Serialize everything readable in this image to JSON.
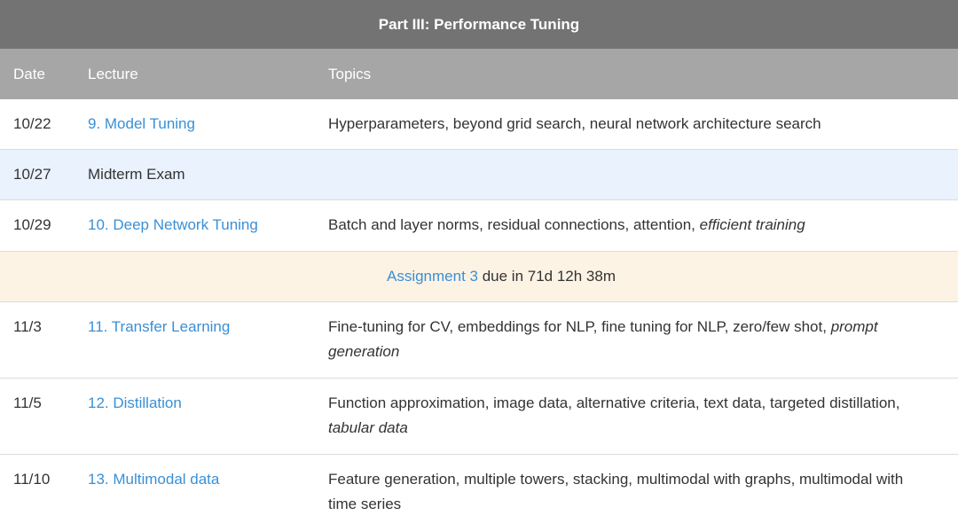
{
  "part": {
    "title": "Part III: Performance Tuning"
  },
  "columns": {
    "date": "Date",
    "lecture": "Lecture",
    "topics": "Topics"
  },
  "rows": [
    {
      "date": "10/22",
      "lecture": "9. Model Tuning",
      "topics": "Hyperparameters, beyond grid search, neural network architecture search",
      "topics_italic": ""
    },
    {
      "date": "10/27",
      "lecture": "Midterm Exam",
      "topics": "",
      "topics_italic": ""
    },
    {
      "date": "10/29",
      "lecture": "10. Deep Network Tuning",
      "topics": "Batch and layer norms, residual connections, attention, ",
      "topics_italic": "efficient training"
    },
    {
      "date": "11/3",
      "lecture": "11. Transfer Learning",
      "topics": "Fine-tuning for CV, embeddings for NLP, fine tuning for NLP, zero/few shot, ",
      "topics_italic": "prompt generation"
    },
    {
      "date": "11/5",
      "lecture": "12. Distillation",
      "topics": "Function approximation, image data, alternative criteria, text data, targeted distillation, ",
      "topics_italic": "tabular data"
    },
    {
      "date": "11/10",
      "lecture": "13. Multimodal data",
      "topics": "Feature generation, multiple towers, stacking, multimodal with graphs, multimodal with time series",
      "topics_italic": ""
    }
  ],
  "assignment": {
    "link": "Assignment 3",
    "due": " due in 71d 12h 38m"
  },
  "colors": {
    "header_dark": "#737373",
    "header_light": "#a6a6a6",
    "link": "#3a8fd6",
    "exam_bg": "#e9f2fd",
    "assignment_bg": "#fdf3e4"
  }
}
